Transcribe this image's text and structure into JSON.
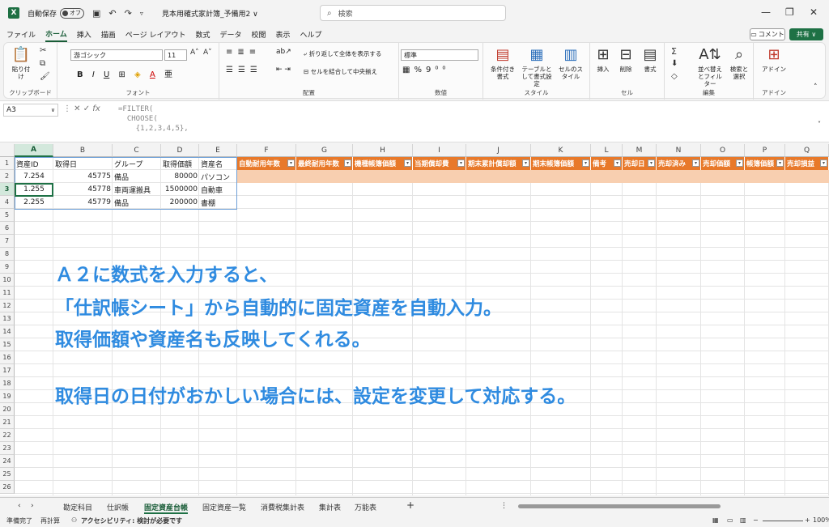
{
  "titlebar": {
    "app_icon": "X",
    "autosave_label": "自動保存",
    "autosave_state": "オフ",
    "doc_title": "見本用確式家計簿_予備用2 ∨",
    "search_placeholder": "検索",
    "icons": [
      "save-icon",
      "undo-icon",
      "redo-icon",
      "customize-icon",
      "minimize-icon",
      "restore-icon",
      "close-icon"
    ]
  },
  "menu": {
    "tabs": [
      "ファイル",
      "ホーム",
      "挿入",
      "描画",
      "ページ レイアウト",
      "数式",
      "データ",
      "校閲",
      "表示",
      "ヘルプ"
    ],
    "active": "ホーム",
    "comment_label": "コメント",
    "share_label": "共有 ∨"
  },
  "ribbon": {
    "clipboard": {
      "paste_label": "貼り付け",
      "group_label": "クリップボード"
    },
    "font": {
      "font_name": "游ゴシック",
      "font_size": "11",
      "group_label": "フォント"
    },
    "alignment": {
      "wrap_label": "折り返して全体を表示する",
      "merge_label": "セルを結合して中央揃え",
      "group_label": "配置"
    },
    "number": {
      "format_value": "標準",
      "group_label": "数値"
    },
    "styles": {
      "conditional_label": "条件付き書式",
      "table_label": "テーブルとして書式設定",
      "cell_style_label": "セルのスタイル",
      "group_label": "スタイル"
    },
    "cells": {
      "insert_label": "挿入",
      "delete_label": "削除",
      "format_label": "書式",
      "group_label": "セル"
    },
    "editing": {
      "sort_label": "並べ替えとフィルター",
      "find_label": "検索と選択",
      "group_label": "編集"
    },
    "addins": {
      "addin_label": "アドイン",
      "group_label": "アドイン"
    }
  },
  "formulabar": {
    "namebox": "A3",
    "formula_lines": [
      "=FILTER(",
      "  CHOOSE(",
      "    {1,2,3,4,5},"
    ]
  },
  "grid": {
    "columns": [
      "A",
      "B",
      "C",
      "D",
      "E",
      "F",
      "G",
      "H",
      "I",
      "J",
      "K",
      "L",
      "M",
      "N",
      "O",
      "P",
      "Q"
    ],
    "rows": [
      "1",
      "2",
      "3",
      "4",
      "5",
      "6",
      "7",
      "8",
      "9",
      "10",
      "11",
      "12",
      "13",
      "14",
      "15",
      "16",
      "17",
      "18",
      "19",
      "20",
      "21",
      "22",
      "23",
      "24",
      "25",
      "26"
    ],
    "selected_col": "A",
    "selected_row": "3",
    "header_row": [
      "資産ID",
      "取得日",
      "グループ",
      "取得価額",
      "資産名"
    ],
    "data_rows": [
      [
        "7.254",
        "45775",
        "備品",
        "80000",
        "パソコン"
      ],
      [
        "1.255",
        "45778",
        "車両運搬具",
        "1500000",
        "自動車"
      ],
      [
        "2.255",
        "45779",
        "備品",
        "200000",
        "書棚"
      ]
    ],
    "orange_headers": [
      "自動耐用年数",
      "最終耐用年数",
      "機種帳簿価額",
      "当期償却費",
      "期末累計償却額",
      "期末帳簿価額",
      "備考",
      "売却日",
      "売却済み",
      "売却価額",
      "帳簿価額",
      "売却損益"
    ],
    "annotation_lines": [
      "Ａ２に数式を入力すると、",
      "「仕訳帳シート」から自動的に固定資産を自動入力。",
      "取得価額や資産名も反映してくれる。",
      "取得日の日付がおかしい場合には、設定を変更して対応する。"
    ]
  },
  "sheets": {
    "tabs": [
      "勘定科目",
      "仕訳帳",
      "固定資産台帳",
      "固定資産一覧",
      "消費税集計表",
      "集計表",
      "万能表"
    ],
    "active": "固定資産台帳"
  },
  "status": {
    "ready": "準備完了",
    "recalc": "再計算",
    "accessibility": "アクセシビリティ: 検討が必要です",
    "zoom": "100%"
  },
  "colors": {
    "excel_green": "#1e7145",
    "orange_header": "#e8792a",
    "annotation_blue": "#2f8be0"
  }
}
